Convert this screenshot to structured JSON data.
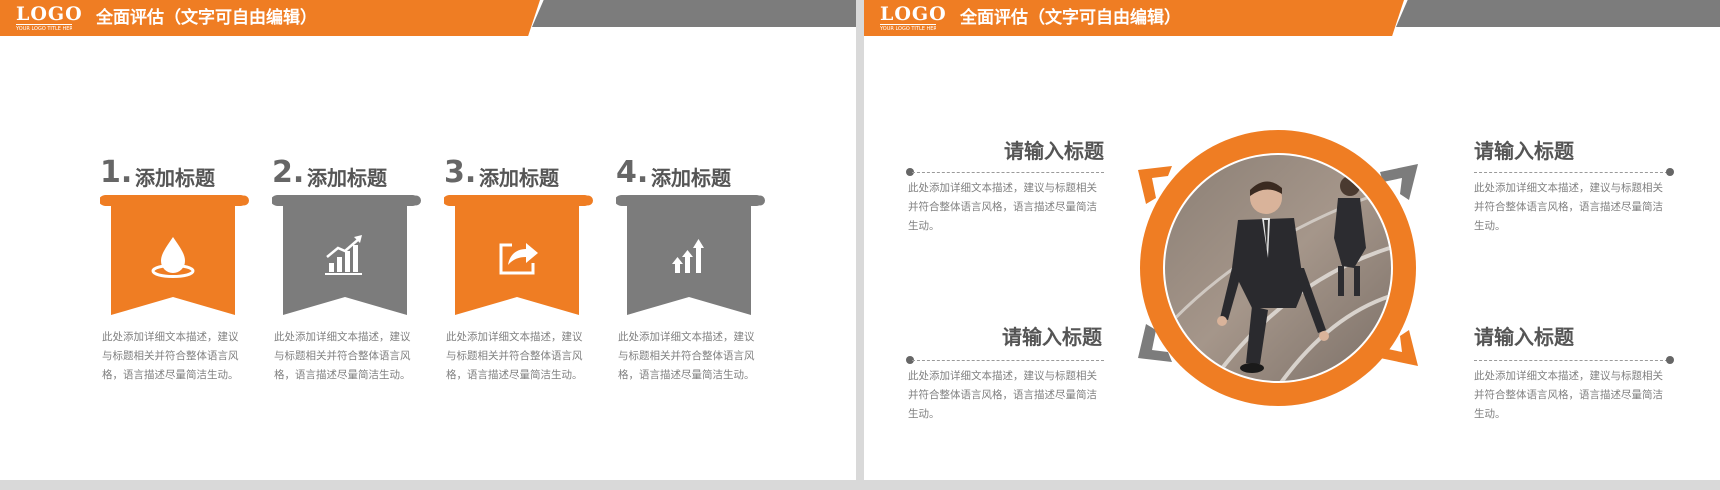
{
  "colors": {
    "accent": "#ef7d23",
    "gray": "#7c7c7c",
    "text": "#808080",
    "heading": "#555555"
  },
  "header": {
    "logo": "LOGO",
    "logo_sub": "YOUR LOGO TITLE HERE",
    "title": "全面评估（文字可自由编辑）"
  },
  "left": {
    "cards": [
      {
        "num": "1.",
        "title": "添加标题",
        "icon": "water-drop-icon",
        "color": "orange",
        "text": "此处添加详细文本描述，建议与标题相关并符合整体语言风格，语言描述尽量简洁生动。"
      },
      {
        "num": "2.",
        "title": "添加标题",
        "icon": "growth-chart-icon",
        "color": "gray",
        "text": "此处添加详细文本描述，建议与标题相关并符合整体语言风格，语言描述尽量简洁生动。"
      },
      {
        "num": "3.",
        "title": "添加标题",
        "icon": "share-icon",
        "color": "orange",
        "text": "此处添加详细文本描述，建议与标题相关并符合整体语言风格，语言描述尽量简洁生动。"
      },
      {
        "num": "4.",
        "title": "添加标题",
        "icon": "rising-arrows-icon",
        "color": "gray",
        "text": "此处添加详细文本描述，建议与标题相关并符合整体语言风格，语言描述尽量简洁生动。"
      }
    ]
  },
  "right": {
    "sections": [
      {
        "title": "请输入标题",
        "text": "此处添加详细文本描述，建议与标题相关并符合整体语言风格，语言描述尽量简洁生动。"
      },
      {
        "title": "请输入标题",
        "text": "此处添加详细文本描述，建议与标题相关并符合整体语言风格，语言描述尽量简洁生动。"
      },
      {
        "title": "请输入标题",
        "text": "此处添加详细文本描述，建议与标题相关并符合整体语言风格，语言描述尽量简洁生动。"
      },
      {
        "title": "请输入标题",
        "text": "此处添加详细文本描述，建议与标题相关并符合整体语言风格，语言描述尽量简洁生动。"
      }
    ],
    "photo": "businessmen-starting-race-photo"
  }
}
